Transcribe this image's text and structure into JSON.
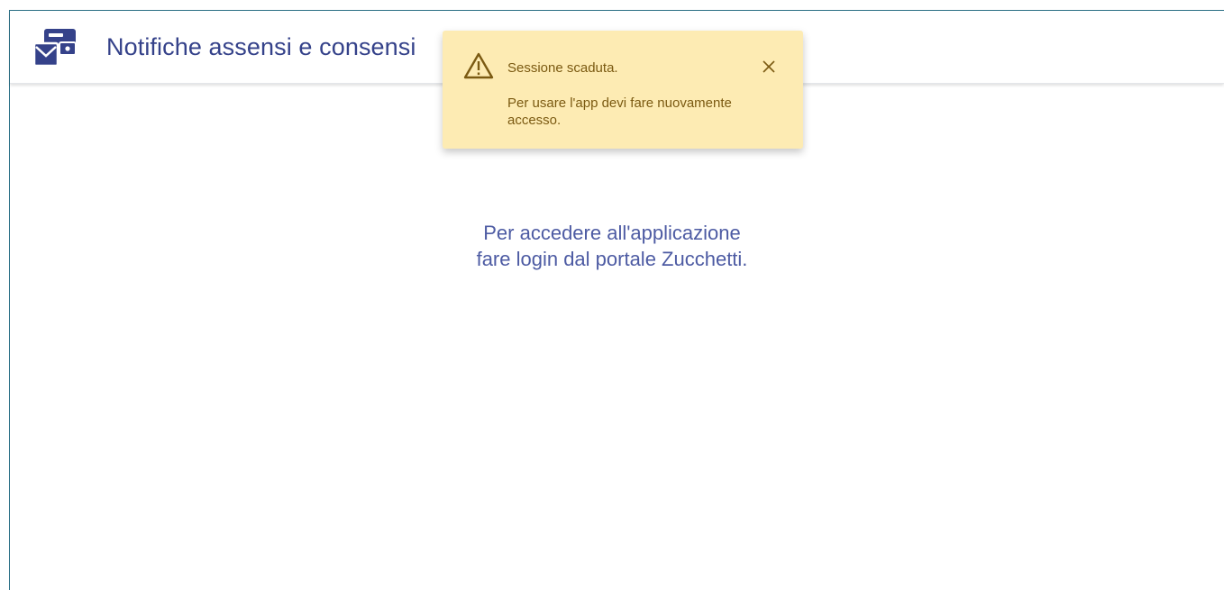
{
  "header": {
    "app_icon": "envelope-wallet-icon",
    "title": "Notifiche assensi e consensi"
  },
  "toast": {
    "icon": "warning-triangle-icon",
    "title": "Sessione scaduta.",
    "message": "Per usare l'app devi fare nuovamente accesso.",
    "close_icon": "close-icon"
  },
  "main": {
    "line1": "Per accedere all'applicazione",
    "line2": "fare login dal portale Zucchetti."
  },
  "colors": {
    "brand": "#35428a",
    "text_secondary": "#4d5ba3",
    "toast_background": "#fdebb3",
    "toast_text": "#7b5a12",
    "frame_border": "#2a6f86"
  }
}
